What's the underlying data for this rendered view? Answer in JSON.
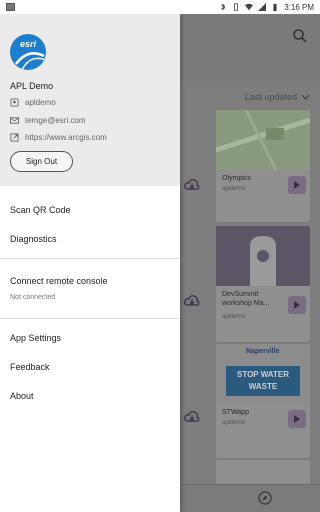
{
  "status_bar": {
    "time": "3:16 PM"
  },
  "drawer": {
    "logo_text": "esri",
    "user_name": "APL Demo",
    "username": "apldemo",
    "email": "temge@esri.com",
    "portal_url": "https://www.arcgis.com",
    "sign_out_label": "Sign Out",
    "menu": {
      "scan_qr": "Scan QR Code",
      "diagnostics": "Diagnostics",
      "connect_console": "Connect remote console",
      "console_status": "Not connected",
      "app_settings": "App Settings",
      "feedback": "Feedback",
      "about": "About"
    }
  },
  "background": {
    "sort_label": "Last updated",
    "cards": [
      {
        "title": "Olympics",
        "owner": "apidemo"
      },
      {
        "title": "DevSummit workshop Ma...",
        "owner": "apldemo"
      },
      {
        "title": "STWapp",
        "owner": "apidemo"
      }
    ],
    "stw_brand": "Naperville",
    "stw_line1": "STOP WATER",
    "stw_line2": "WASTE"
  },
  "colors": {
    "esri_blue": "#1d7ed0",
    "accent_purple": "#7b4fa0"
  }
}
